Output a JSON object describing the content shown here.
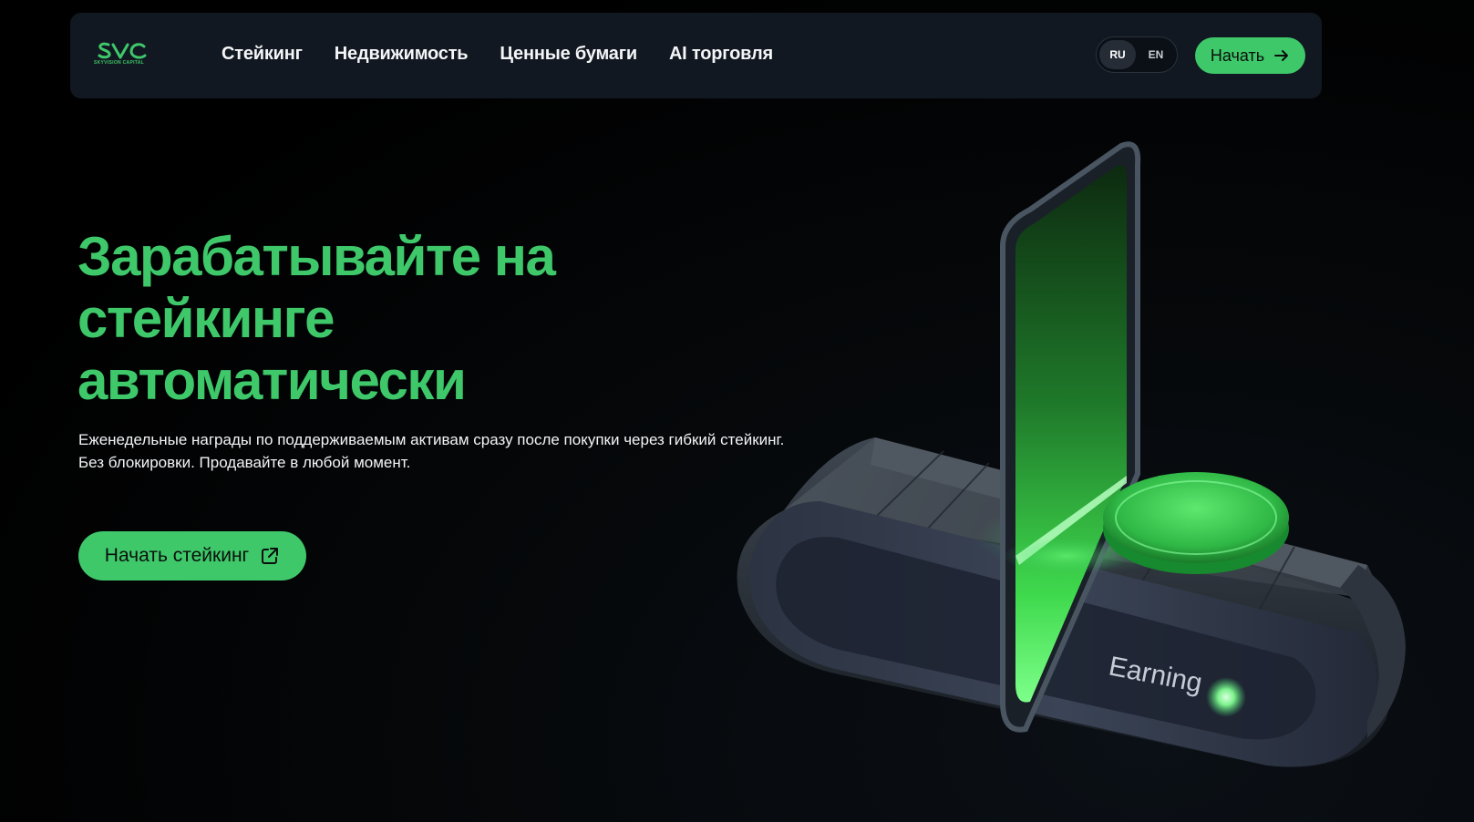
{
  "brand": {
    "logo_text": "SVC",
    "logo_subtitle": "SKYVISION CAPITAL",
    "accent_color": "#3ec86a"
  },
  "nav": {
    "links": [
      {
        "label": "Стейкинг"
      },
      {
        "label": "Недвижимость"
      },
      {
        "label": "Ценные бумаги"
      },
      {
        "label": "AI торговля"
      }
    ],
    "languages": [
      {
        "code": "RU",
        "active": true
      },
      {
        "code": "EN",
        "active": false
      }
    ],
    "cta_label": "Начать",
    "cta_icon": "arrow-right-icon"
  },
  "hero": {
    "title_lines": [
      "Зарабатывайте на",
      "стейкинге",
      "автоматически"
    ],
    "subtitle_lines": [
      "Еженедельные награды по поддерживаемым активам сразу после покупки через гибкий стейкинг.",
      "Без блокировки. Продавайте в любой момент."
    ],
    "cta_label": "Начать стейкинг",
    "cta_icon": "external-link-icon"
  },
  "illustration": {
    "device_label": "Earning"
  }
}
